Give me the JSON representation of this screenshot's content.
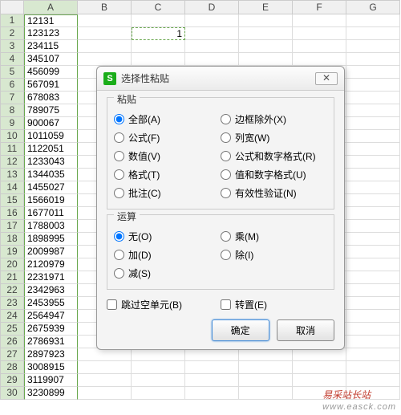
{
  "columns": [
    "A",
    "B",
    "C",
    "D",
    "E",
    "F",
    "G"
  ],
  "rows": [
    {
      "n": 1,
      "a": "12131"
    },
    {
      "n": 2,
      "a": "123123"
    },
    {
      "n": 3,
      "a": "234115"
    },
    {
      "n": 4,
      "a": "345107"
    },
    {
      "n": 5,
      "a": "456099"
    },
    {
      "n": 6,
      "a": "567091"
    },
    {
      "n": 7,
      "a": "678083"
    },
    {
      "n": 8,
      "a": "789075"
    },
    {
      "n": 9,
      "a": "900067"
    },
    {
      "n": 10,
      "a": "1011059"
    },
    {
      "n": 11,
      "a": "1122051"
    },
    {
      "n": 12,
      "a": "1233043"
    },
    {
      "n": 13,
      "a": "1344035"
    },
    {
      "n": 14,
      "a": "1455027"
    },
    {
      "n": 15,
      "a": "1566019"
    },
    {
      "n": 16,
      "a": "1677011"
    },
    {
      "n": 17,
      "a": "1788003"
    },
    {
      "n": 18,
      "a": "1898995"
    },
    {
      "n": 19,
      "a": "2009987"
    },
    {
      "n": 20,
      "a": "2120979"
    },
    {
      "n": 21,
      "a": "2231971"
    },
    {
      "n": 22,
      "a": "2342963"
    },
    {
      "n": 23,
      "a": "2453955"
    },
    {
      "n": 24,
      "a": "2564947"
    },
    {
      "n": 25,
      "a": "2675939"
    },
    {
      "n": 26,
      "a": "2786931"
    },
    {
      "n": 27,
      "a": "2897923"
    },
    {
      "n": 28,
      "a": "3008915"
    },
    {
      "n": 29,
      "a": "3119907"
    },
    {
      "n": 30,
      "a": "3230899"
    }
  ],
  "dashed_cell": {
    "col": "C",
    "row": 2,
    "value": "1"
  },
  "dialog": {
    "icon_letter": "S",
    "title": "选择性粘贴",
    "paste_legend": "粘贴",
    "paste_options": [
      {
        "label": "全部(A)",
        "checked": true
      },
      {
        "label": "边框除外(X)"
      },
      {
        "label": "公式(F)"
      },
      {
        "label": "列宽(W)"
      },
      {
        "label": "数值(V)"
      },
      {
        "label": "公式和数字格式(R)"
      },
      {
        "label": "格式(T)"
      },
      {
        "label": "值和数字格式(U)"
      },
      {
        "label": "批注(C)"
      },
      {
        "label": "有效性验证(N)"
      }
    ],
    "op_legend": "运算",
    "op_options": [
      {
        "label": "无(O)",
        "checked": true
      },
      {
        "label": "乘(M)"
      },
      {
        "label": "加(D)"
      },
      {
        "label": "除(I)"
      },
      {
        "label": "减(S)"
      }
    ],
    "skip_blanks": "跳过空单元(B)",
    "transpose": "转置(E)",
    "ok": "确定",
    "cancel": "取消"
  },
  "watermark": {
    "main": "易采站长站",
    "sub": "www.easck.com"
  }
}
